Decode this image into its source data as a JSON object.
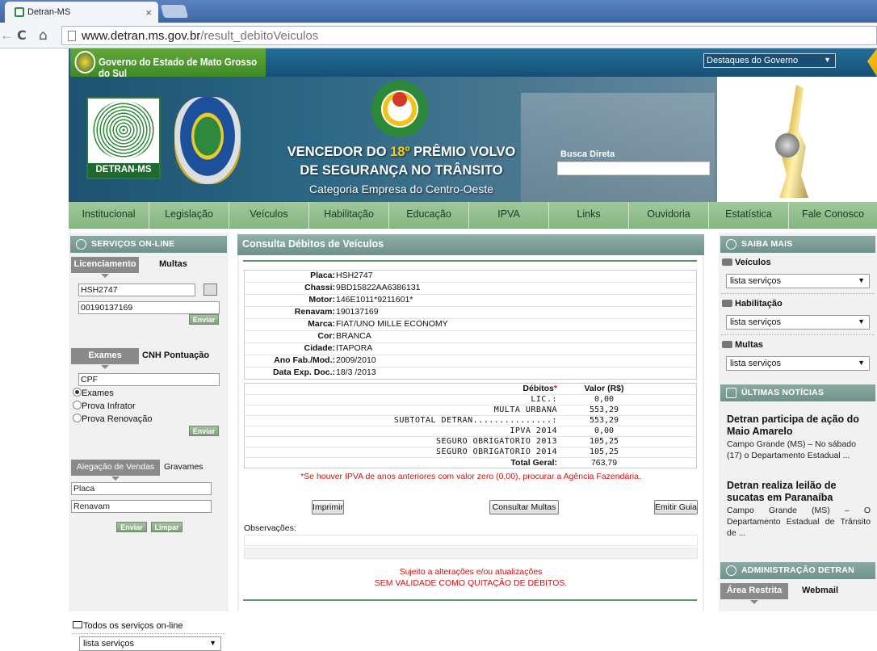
{
  "browser": {
    "tab_title": "Detran-MS",
    "tab_close": "×",
    "back": "←",
    "reload": "C",
    "home": "⌂",
    "url_host": "www.detran.ms.gov.br",
    "url_path": "/result_debitoVeiculos"
  },
  "gov_bar": {
    "title": "Governo do Estado de Mato Grosso do Sul",
    "select_value": "Destaques do Governo"
  },
  "banner": {
    "detran_logo": "DETRAN-MS",
    "headline_1a": "VENCEDOR DO ",
    "headline_1b": "18º",
    "headline_1c": " PRÊMIO VOLVO",
    "headline_2": "DE SEGURANÇA NO TRÂNSITO",
    "headline_3": "Categoria Empresa do Centro-Oeste",
    "busca_label": "Busca Direta"
  },
  "menu": [
    "Institucional",
    "Legislação",
    "Veículos",
    "Habilitação",
    "Educação",
    "IPVA",
    "Links",
    "Ouvidoria",
    "Estatística",
    "Fale Conosco"
  ],
  "left": {
    "services_title": "SERVIÇOS ON-LINE",
    "tab_licenciamento": "Licenciamento",
    "tab_multas": "Multas",
    "placa_value": "HSH2747",
    "renavam_value": "00190137169",
    "enviar": "Enviar",
    "tab_exames": "Exames",
    "tab_cnh": "CNH Pontuação",
    "cpf_value": "CPF",
    "radio_exames": "Exames",
    "radio_infrator": "Prova Infrator",
    "radio_renovacao": "Prova Renovação",
    "tab_alegacao": "Alegação de Vendas",
    "tab_gravames": "Gravames",
    "placa_placeholder": "Placa",
    "renavam_placeholder": "Renavam",
    "limpar": "Limpar",
    "todos_servicos": "Todos os serviços on-line",
    "lista_servicos": "lista serviços"
  },
  "main": {
    "title": "Consulta Débitos de Veículos",
    "vehicle": [
      {
        "k": "Placa:",
        "v": "HSH2747"
      },
      {
        "k": "Chassi:",
        "v": "9BD15822AA6386131"
      },
      {
        "k": "Motor:",
        "v": "146E1011*9211601*"
      },
      {
        "k": "Renavam:",
        "v": "190137169"
      },
      {
        "k": "Marca:",
        "v": "FIAT/UNO MILLE ECONOMY"
      },
      {
        "k": "Cor:",
        "v": "BRANCA"
      },
      {
        "k": "Cidade:",
        "v": "ITAPORA"
      },
      {
        "k": "Ano Fab./Mod.:",
        "v": "2009/2010"
      },
      {
        "k": "Data Exp. Doc.:",
        "v": "18/3 /2013"
      }
    ],
    "debitos_header": "Débitos",
    "debitos_star": "*",
    "valor_header": "Valor (R$)",
    "debitos": [
      {
        "k": "LIC.:",
        "v": "0,00"
      },
      {
        "k": "MULTA URBANA",
        "v": "553,29"
      },
      {
        "k": "SUBTOTAL DETRAN...............:",
        "v": "553,29"
      },
      {
        "k": "IPVA 2014",
        "v": "0,00"
      },
      {
        "k": "SEGURO OBRIGATORIO 2013",
        "v": "105,25"
      },
      {
        "k": "SEGURO OBRIGATORIO 2014",
        "v": "105,25"
      }
    ],
    "total_label": "Total Geral:",
    "total_value": "763,79",
    "ipva_note": "*Se houver IPVA de anos anteriores com valor zero (0,00), procurar a Agência Fazendária.",
    "btn_imprimir": "Imprimir",
    "btn_multas": "Consultar Multas",
    "btn_guia": "Emitir Guia",
    "obs_label": "Observações:",
    "footer_1": "Sujeito a alterações e/ou atualizações",
    "footer_2": "SEM VALIDADE COMO QUITAÇÃO DE DÉBITOS."
  },
  "right": {
    "saiba_title": "SAIBA MAIS",
    "cat_veiculos": "Veículos",
    "cat_habilitacao": "Habilitação",
    "cat_multas": "Multas",
    "lista_servicos": "lista serviços",
    "news_title": "ÚLTIMAS NOTÍCIAS",
    "news": [
      {
        "title": "Detran participa de ação do Maio Amarelo",
        "desc": "Campo Grande (MS) – No sábado (17) o Departamento Estadual ..."
      },
      {
        "title": "Detran realiza leilão de sucatas em Paranaíba",
        "desc": "Campo Grande (MS) – O Departamento Estadual de Trânsito de ..."
      }
    ],
    "admin_title": "ADMINISTRAÇÃO DETRAN",
    "tab_area": "Área Restrita",
    "tab_webmail": "Webmail"
  }
}
